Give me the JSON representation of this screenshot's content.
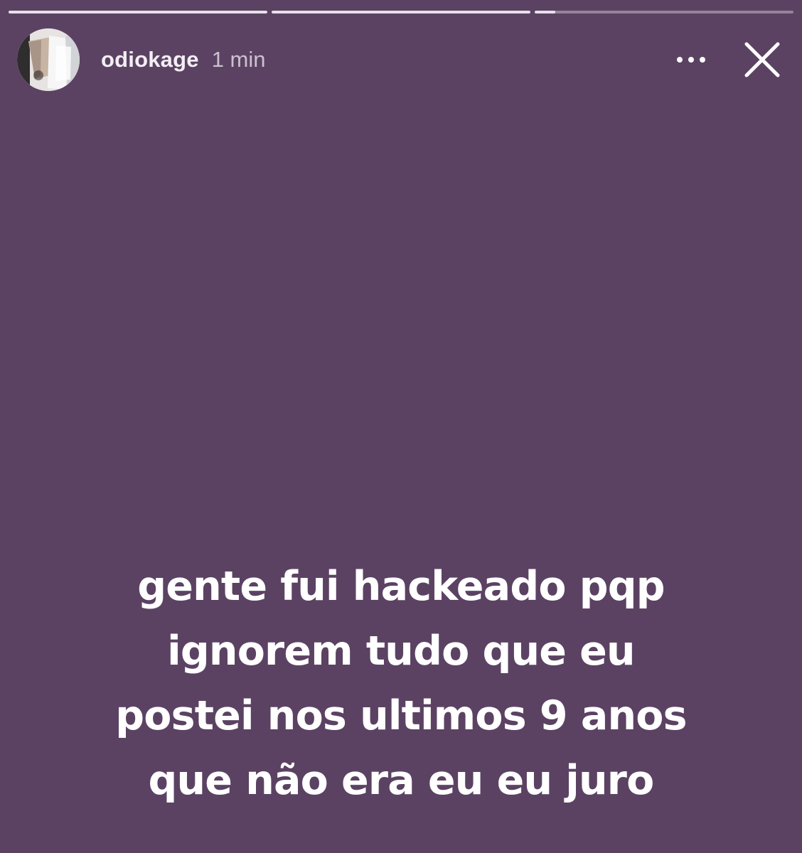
{
  "story": {
    "username": "odiokage",
    "time": "1 min",
    "text_lines": [
      "gente fui hackeado pqp",
      "ignorem tudo que eu",
      "postei nos ultimos 9 anos",
      "que não era eu eu juro"
    ],
    "progress": [
      1,
      1,
      0.08
    ],
    "icons": {
      "more": "more-icon",
      "close": "close-icon",
      "avatar": "avatar-image"
    },
    "colors": {
      "background": "#5b4263",
      "text": "#ffffff",
      "progress_active": "#e6e1e8"
    }
  }
}
